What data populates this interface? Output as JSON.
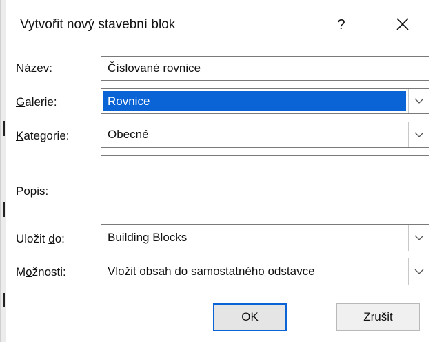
{
  "dialog": {
    "title": "Vytvořit nový stavební blok",
    "help_label": "?",
    "close_icon": "close-icon"
  },
  "fields": {
    "name": {
      "label_accel": "N",
      "label_rest": "ázev:",
      "value": "Číslované rovnice"
    },
    "gallery": {
      "label_accel": "G",
      "label_rest": "alerie:",
      "value": "Rovnice"
    },
    "category": {
      "label_accel": "K",
      "label_rest": "ategorie:",
      "value": "Obecné"
    },
    "description": {
      "label_accel": "P",
      "label_rest": "opis:",
      "value": ""
    },
    "save_in": {
      "label_pre": "Uložit ",
      "label_accel": "d",
      "label_rest": "o:",
      "value": "Building Blocks"
    },
    "options": {
      "label_pre": "M",
      "label_accel": "o",
      "label_rest": "žnosti:",
      "value": "Vložit obsah do samostatného odstavce"
    }
  },
  "buttons": {
    "ok": "OK",
    "cancel": "Zrušit"
  },
  "colors": {
    "selection": "#0a64d6",
    "default_button_border": "#0a64d6"
  }
}
